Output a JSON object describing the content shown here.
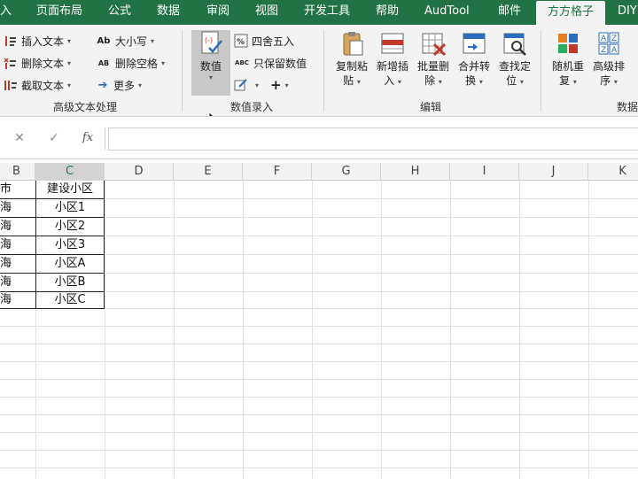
{
  "tabs": [
    {
      "label": "入"
    },
    {
      "label": "页面布局"
    },
    {
      "label": "公式"
    },
    {
      "label": "数据"
    },
    {
      "label": "审阅"
    },
    {
      "label": "视图"
    },
    {
      "label": "开发工具"
    },
    {
      "label": "帮助"
    },
    {
      "label": "AudTool"
    },
    {
      "label": "邮件"
    },
    {
      "label": "方方格子"
    },
    {
      "label": "DIY"
    }
  ],
  "ribbon": {
    "text_group": {
      "insert_text": "插入文本",
      "delete_text": "删除文本",
      "extract_text": "截取文本",
      "case": "大小写",
      "delete_space": "删除空格",
      "more": "更多",
      "label": "高级文本处理",
      "case_icon": "Ab",
      "space_icon": "AB"
    },
    "numeric_group": {
      "value_btn": "数值",
      "round": "四舍五入",
      "keep_value": "只保留数值",
      "plus": "+",
      "label": "数值录入",
      "keep_icon": "ABC"
    },
    "edit_group": {
      "copy_paste_1": "复制粘",
      "copy_paste_2": "贴",
      "new_insert_1": "新增插",
      "new_insert_2": "入",
      "batch_delete_1": "批量删",
      "batch_delete_2": "除",
      "merge_convert_1": "合并转",
      "merge_convert_2": "换",
      "find_locate_1": "查找定",
      "find_locate_2": "位",
      "label": "编辑"
    },
    "data_group": {
      "random_1": "随机重",
      "random_2": "复",
      "sort_1": "高级排",
      "sort_2": "序",
      "label": "数据"
    }
  },
  "formula_bar": {
    "cancel": "✕",
    "confirm": "✓",
    "fx": "fx",
    "value": ""
  },
  "columns": [
    "B",
    "C",
    "D",
    "E",
    "F",
    "G",
    "H",
    "I",
    "J",
    "K"
  ],
  "table": {
    "b_values": [
      "市",
      "海",
      "海",
      "海",
      "海",
      "海",
      "海"
    ],
    "c_values": [
      "建设小区",
      "小区1",
      "小区2",
      "小区3",
      "小区A",
      "小区B",
      "小区C"
    ]
  },
  "colors": {
    "accent": "#217346",
    "ribbon_bg": "#f3f3f3",
    "header_selected": "#d3d3d3"
  }
}
